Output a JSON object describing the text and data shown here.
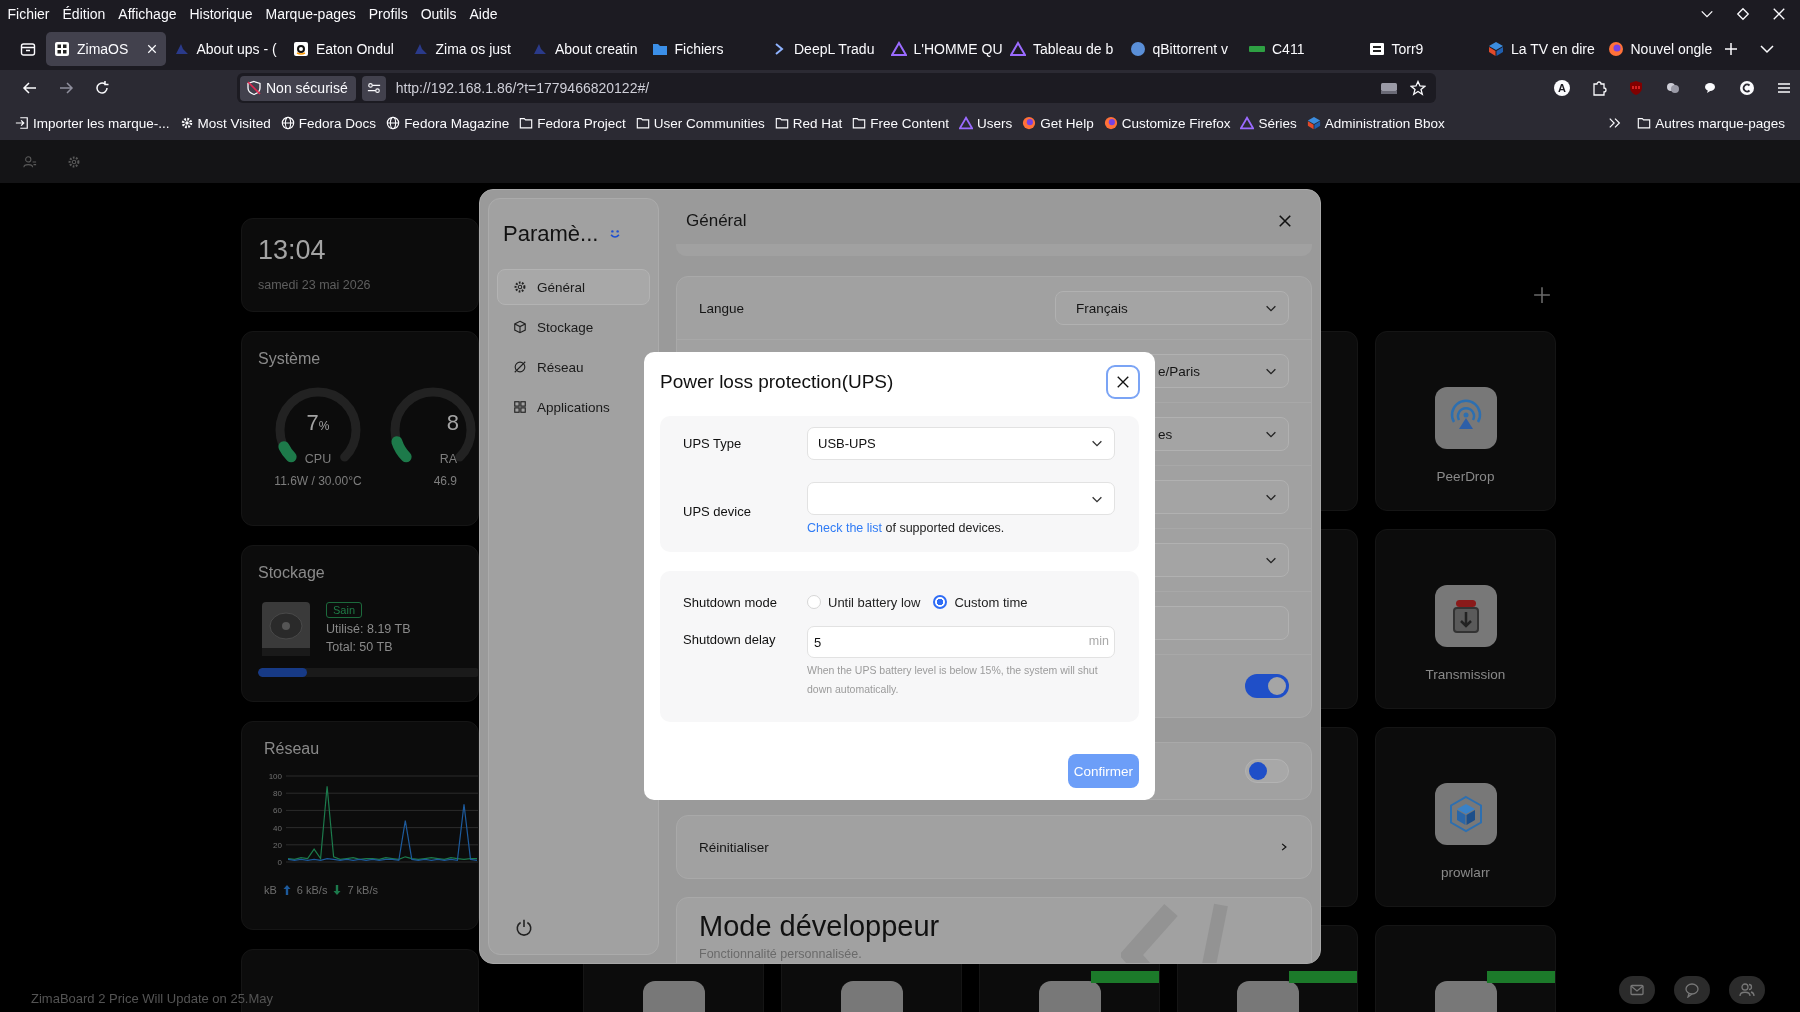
{
  "menu_bar": [
    "Fichier",
    "Édition",
    "Affichage",
    "Historique",
    "Marque-pages",
    "Profils",
    "Outils",
    "Aide"
  ],
  "tabs": [
    {
      "label": "ZimaOS",
      "selected": true
    },
    {
      "label": "About ups - (",
      "selected": false
    },
    {
      "label": "Eaton Ondul",
      "selected": false
    },
    {
      "label": "Zima os just",
      "selected": false
    },
    {
      "label": "About creatin",
      "selected": false
    },
    {
      "label": "Fichiers",
      "selected": false
    },
    {
      "label": "DeepL Tradu",
      "selected": false
    },
    {
      "label": "L'HOMME QU",
      "selected": false
    },
    {
      "label": "Tableau de b",
      "selected": false
    },
    {
      "label": "qBittorrent v",
      "selected": false
    },
    {
      "label": "C411",
      "selected": false
    },
    {
      "label": "Torr9",
      "selected": false
    },
    {
      "label": "La TV en dire",
      "selected": false
    },
    {
      "label": "Nouvel ongle",
      "selected": false
    }
  ],
  "address_bar": {
    "security": "Non sécurisé",
    "url": "http://192.168.1.86/?t=1779466820122#/"
  },
  "toolbar": {
    "profile_letter": "A"
  },
  "bookmarks": [
    "Importer les marque-...",
    "Most Visited",
    "Fedora Docs",
    "Fedora Magazine",
    "Fedora Project",
    "User Communities",
    "Red Hat",
    "Free Content",
    "Users",
    "Get Help",
    "Customize Firefox",
    "Séries",
    "Administration Bbox"
  ],
  "other_bookmarks": "Autres marque-pages",
  "dashboard": {
    "clock": {
      "time": "13:04",
      "date": "samedi 23 mai 2026"
    },
    "system": {
      "title": "Système",
      "gauges": [
        {
          "value": "7",
          "unit": "%",
          "label": "CPU",
          "detail": "11.6W / 30.00°C",
          "level": 0.07
        },
        {
          "value": "8",
          "label": "RA",
          "detail": "46.9",
          "level": 0.1
        }
      ]
    },
    "storage": {
      "title": "Stockage",
      "status": "Sain",
      "used": "Utilisé: 8.19 TB",
      "total": "Total: 50 TB",
      "level": 0.22
    },
    "network": {
      "title": "Réseau",
      "unit": "kB",
      "upload": "6 kB/s",
      "download": "7 kB/s",
      "chart_data": {
        "type": "line",
        "grid": true,
        "ylim": [
          0,
          100
        ],
        "yticks": [
          0,
          20,
          40,
          60,
          80,
          100
        ],
        "series": [
          {
            "color": "#1c7a4c",
            "values": [
              4,
              3,
              5,
              4,
              15,
              4,
              88,
              6,
              3,
              4,
              5,
              3,
              4,
              4,
              3,
              5,
              4,
              3,
              6,
              4,
              3,
              4,
              5,
              4,
              3,
              5,
              4,
              3,
              4,
              4
            ]
          },
          {
            "color": "#1d5a9c",
            "values": [
              3,
              2,
              3,
              2,
              3,
              2,
              4,
              3,
              2,
              3,
              2,
              3,
              2,
              3,
              2,
              3,
              3,
              2,
              48,
              3,
              2,
              3,
              2,
              3,
              2,
              3,
              2,
              67,
              3,
              2
            ]
          }
        ]
      }
    },
    "apps": [
      {
        "name": "PeerDrop"
      },
      {
        "name": "Transmission"
      },
      {
        "name": "prowlarr"
      }
    ],
    "bottom_row": [
      {
        "highlighted": false
      },
      {
        "highlighted": false
      },
      {
        "highlighted": true
      },
      {
        "highlighted": true
      },
      {
        "highlighted": true
      }
    ],
    "footer": "ZimaBoard 2 Price Will Update on 25.May"
  },
  "settings": {
    "title": "Paramè...",
    "nav": [
      {
        "label": "Général",
        "selected": true
      },
      {
        "label": "Stockage",
        "selected": false
      },
      {
        "label": "Réseau",
        "selected": false
      },
      {
        "label": "Applications",
        "selected": false
      }
    ],
    "heading": "Général",
    "rows": [
      {
        "kind": "select",
        "label": "Langue",
        "value": "Français"
      },
      {
        "kind": "select",
        "value": "e/Paris"
      },
      {
        "kind": "select",
        "value": "es"
      },
      {
        "kind": "select"
      },
      {
        "kind": "select"
      },
      {
        "kind": "input"
      },
      {
        "kind": "toggle",
        "on": true
      }
    ],
    "extra_toggle": {
      "on": false
    },
    "reset": "Réinitialiser",
    "developer": {
      "title": "Mode développeur",
      "subtitle": "Fonctionnalité personnalisée."
    }
  },
  "ups_dialog": {
    "title": "Power loss protection(UPS)",
    "type": {
      "label": "UPS Type",
      "value": "USB-UPS"
    },
    "device": {
      "label": "UPS device",
      "help_link": "Check the list",
      "help_text": "of supported devices."
    },
    "mode": {
      "label": "Shutdown mode",
      "options": [
        {
          "label": "Until battery low",
          "selected": false
        },
        {
          "label": "Custom time",
          "selected": true
        }
      ]
    },
    "delay": {
      "label": "Shutdown delay",
      "value": "5",
      "unit": "min",
      "hint": "When the UPS battery level is below 15%, the system will shut down automatically."
    },
    "confirm": "Confirmer"
  }
}
